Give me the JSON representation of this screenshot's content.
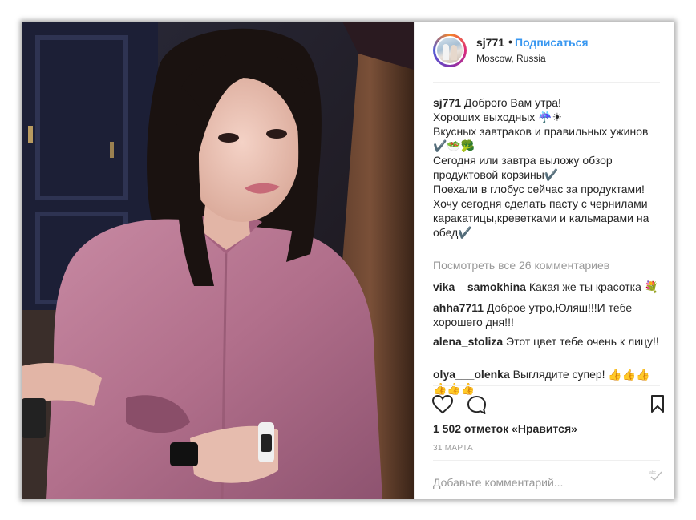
{
  "post": {
    "username": "sj771",
    "separator": "•",
    "follow_label": "Подписаться",
    "location": "Moscow, Russia"
  },
  "caption": {
    "username": "sj771",
    "lines": [
      " Доброго Вам утра!",
      "",
      "Хороших выходных ☔☀",
      "Вкусных завтраков и правильных ужинов",
      "✔️🥗🥦",
      "Сегодня или завтра выложу обзор",
      "продуктовой корзины✔️",
      "Поехали в глобус сейчас за продуктами!",
      "Хочу сегодня сделать пасту с чернилами",
      "каракатицы,креветками и кальмарами на",
      "обед✔️"
    ]
  },
  "view_all_comments": "Посмотреть все 26 комментариев",
  "comments": [
    {
      "username": "vika__samokhina",
      "text": "Какая же ты красотка 💐"
    },
    {
      "username": "ahha7711",
      "text": "Доброе утро,Юляш!!!И тебе хорошего дня!!!"
    },
    {
      "username": "alena_stoliza",
      "text": "Этот цвет тебе очень к лицу!!"
    },
    {
      "username": "olya___olenka",
      "text": "Выглядите супер! 👍👍👍👍👍👍"
    }
  ],
  "actions": {
    "like_icon": "heart-outline-icon",
    "comment_icon": "speech-bubble-icon",
    "save_icon": "bookmark-outline-icon"
  },
  "likes_text": "1 502 отметок «Нравится»",
  "date": "31 МАРТА",
  "add_comment_placeholder": "Добавьте комментарий...",
  "more_icon": "ellipsis-icon",
  "colors": {
    "link": "#3897f0",
    "text": "#262626",
    "secondary": "#999999",
    "dress": "#b9738f"
  }
}
